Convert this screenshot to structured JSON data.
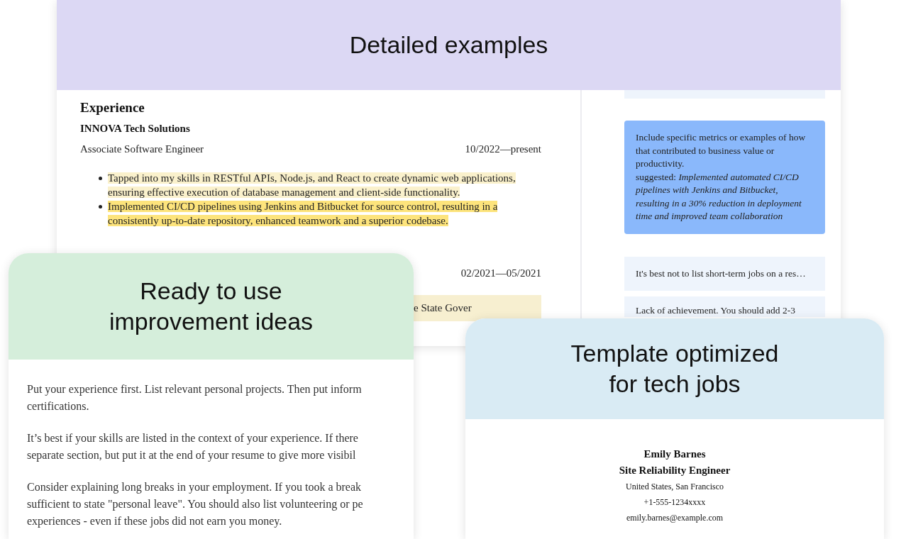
{
  "examples_card": {
    "title": "Detailed examples",
    "resume": {
      "section": "Experience",
      "jobs": [
        {
          "company": "INNOVA Tech Solutions",
          "role": "Associate Software Engineer",
          "dates": "10/2022—present",
          "bullets": [
            {
              "kind": "bullet",
              "text": "Tapped into my skills in RESTful APIs, Node.js, and React to create dynamic web applications, ensuring effective execution of database management and client-side functionality.",
              "color": "#faf1cc"
            },
            {
              "kind": "bullet",
              "text": "Implemented CI/CD pipelines using Jenkins and Bitbucket for source control, resulting in a consistently up-to-date repository, enhanced teamwork and a superior codebase.",
              "color": "#fde47c"
            }
          ]
        },
        {
          "dates": "02/2021—05/2021",
          "bullets": [
            {
              "kind": "excerpt",
              "text": "e State Gover",
              "color": "#f7efd0"
            }
          ]
        }
      ]
    },
    "tips": [
      {
        "text": "Include specific metrics or examples of how that contributed to business value or productivity.",
        "suggestion": "suggested: *Implemented automated CI/CD pipelines with Jenkins and Bitbucket, resulting in a 30% reduction in deployment time and improved team collaboration*",
        "selected": true
      },
      {
        "text": "It's best not to list short-term jobs on a res…",
        "selected": false
      },
      {
        "text": "Lack of achievement. You should add 2-3",
        "selected": false
      }
    ]
  },
  "ideas_card": {
    "title": "Ready to use improvement ideas",
    "paragraphs": [
      "Put your experience first. List relevant personal projects. Then put inform\ncertifications.",
      "It’s best if your skills are listed in the context of your experience. If there\nseparate section, but put it at the end of your resume to give more visibil",
      "Consider explaining long breaks in your employment. If you took a break\nsufficient to state \"personal leave\". You should also list volunteering or pe\nexperiences - even if these jobs did not earn you money."
    ]
  },
  "template_card": {
    "title": "Template optimized for tech jobs",
    "name": "Emily Barnes",
    "job_title": "Site Reliability Engineer",
    "location": "United States, San Francisco",
    "phone": "+1-555-1234xxxx",
    "email": "emily.barnes@example.com"
  }
}
